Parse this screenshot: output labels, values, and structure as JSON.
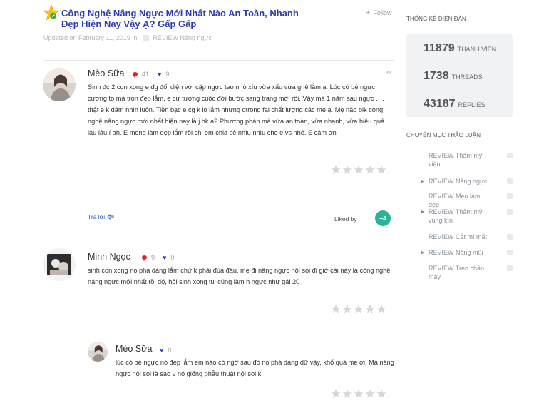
{
  "thread": {
    "title": "Công Nghệ Nâng Ngực Mới Nhất Nào An Toàn, Nhanh Đẹp Hiện Nay Vậy Ạ? Gấp Gấp",
    "follow_label": "Follow",
    "updated": "Updated on February 11, 2019 in",
    "category": "REVIEW Nâng ngực"
  },
  "posts": [
    {
      "author": "Mèo Sữa",
      "comments": "41",
      "likes": "9",
      "body": "Sinh đc 2 con xong e đg đối diện với cặp ngực teo nhỏ xíu vừa xấu vừa ghê lắm ạ. Lúc có bé ngực cương to mà tròn đẹp lắm, e cứ tưởng cuộc đời bước sang trang mới rồi. Vậy mà 1 năm sau ngực …. thật e k dám nhìn luôn. Tiền bạc e cg k lo lắm nhưng qtrong fai chất lượng các mẹ ạ. Mẹ nào bik công nghệ nâng ngực mới nhất hiện nay là j hk ạ? Phương pháp mà vừa an toàn, vừa nhanh, vừa hiệu quả lâu lâu í ah. E mong làm đẹp lắm rồi chị em chia sẻ nhìu nhìu cho e vs nhé. E cảm ơn",
      "reply_label": "Trả lời",
      "liked_by_label": "Liked by",
      "like_count": "+4"
    },
    {
      "author": "Minh Ngọc",
      "comments": "9",
      "likes": "0",
      "body": "sinh con xong nó phá dáng lắm chứ k phải đùa đâu, mẹ đi nâng ngực nội soi đi giờ cái này là công nghệ nâng ngực mới nhất rồi đó, hồi sinh xong tui cũng làm h ngực như gái 20"
    },
    {
      "author": "Mèo Sữa",
      "likes": "0",
      "body": "lúc có bé ngực nó đẹp lắm em nào có ngờ sau đó nó phá dáng dữ vậy, khổ quá mẹ ơi. Mà nâng ngực nội soi là sao v nó giống phẫu thuật nội soi k"
    }
  ],
  "sidebar": {
    "stats_heading": "Thống kê diễn đàn",
    "stats": [
      {
        "value": "11879",
        "label": "Thành viên"
      },
      {
        "value": "1738",
        "label": "Threads"
      },
      {
        "value": "43187",
        "label": "Replies"
      }
    ],
    "categories_heading": "Chuyên mục thảo luận",
    "categories": [
      {
        "label": "REVIEW Thẩm mỹ viện",
        "has_children": false
      },
      {
        "label": "REVIEW Nâng ngực",
        "has_children": true
      },
      {
        "label": "REVIEW Mẹo làm đẹp",
        "has_children": false
      },
      {
        "label": "REVIEW Thẩm mỹ vùng kín",
        "has_children": true
      },
      {
        "label": "REVIEW Cắt mí mắt",
        "has_children": false
      },
      {
        "label": "REVIEW Nâng mũi",
        "has_children": true
      },
      {
        "label": "REVIEW Treo chân mày",
        "has_children": false
      }
    ]
  },
  "colors": {
    "title": "#2b3db1",
    "comment_bubble": "#e32323",
    "heart": "#2438c7",
    "like_badge": "#2ab39a",
    "star_empty": "#d6d6d6"
  }
}
